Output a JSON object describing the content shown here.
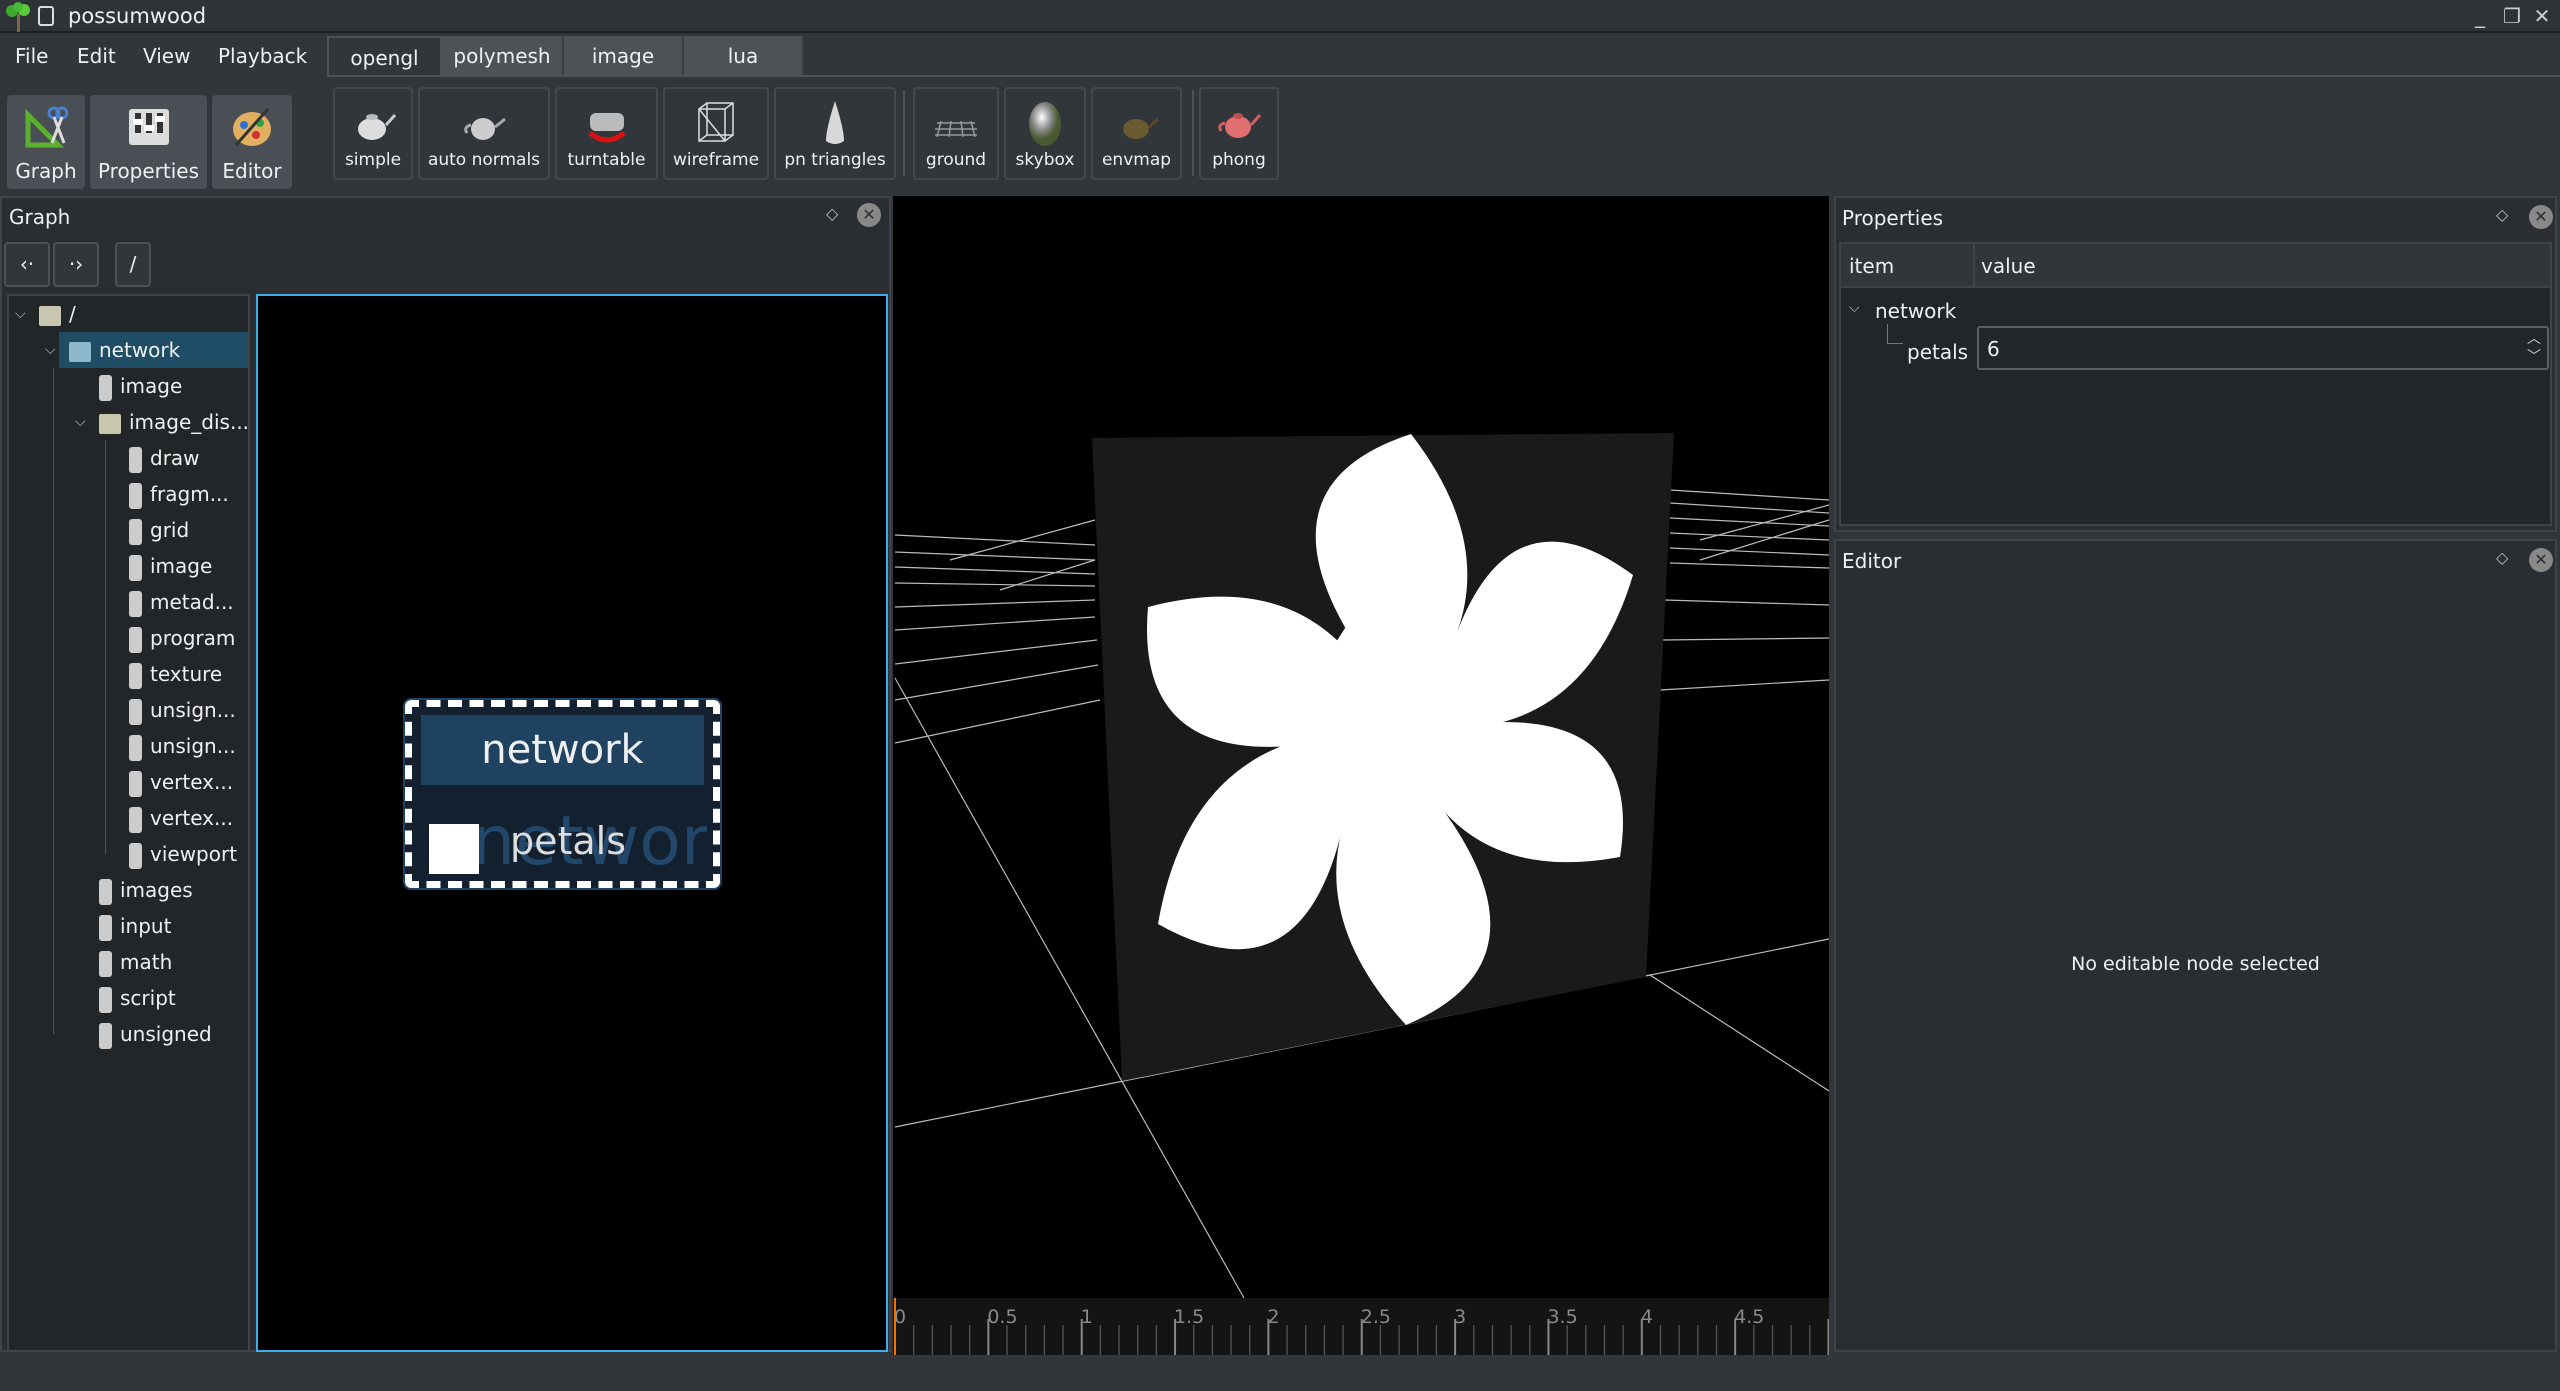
{
  "window": {
    "title": "possumwood",
    "controls": [
      "minimize",
      "maximize",
      "close"
    ]
  },
  "menu": [
    "File",
    "Edit",
    "View",
    "Playback"
  ],
  "dock_buttons": [
    {
      "label": "Graph",
      "icon": "graph-tools-icon"
    },
    {
      "label": "Properties",
      "icon": "sliders-icon"
    },
    {
      "label": "Editor",
      "icon": "palette-icon"
    }
  ],
  "tabs": [
    {
      "label": "opengl",
      "active": true
    },
    {
      "label": "polymesh",
      "active": false
    },
    {
      "label": "image",
      "active": false
    },
    {
      "label": "lua",
      "active": false
    }
  ],
  "toolbar": [
    {
      "label": "simple",
      "icon": "teapot-icon"
    },
    {
      "label": "auto normals",
      "icon": "teapot-icon"
    },
    {
      "label": "turntable",
      "icon": "car-rotate-icon"
    },
    {
      "label": "wireframe",
      "icon": "wireframe-box-icon"
    },
    {
      "label": "pn triangles",
      "icon": "cone-icon"
    },
    {
      "label": "ground",
      "icon": "ground-grid-icon"
    },
    {
      "label": "skybox",
      "icon": "sphere-icon"
    },
    {
      "label": "envmap",
      "icon": "teapot-env-icon"
    },
    {
      "label": "phong",
      "icon": "red-teapot-icon"
    }
  ],
  "graph_panel": {
    "title": "Graph",
    "nav": {
      "back": "back-icon",
      "forward": "forward-icon",
      "path": "/"
    },
    "tree": [
      {
        "label": "/",
        "depth": 0,
        "type": "folder",
        "expanded": true
      },
      {
        "label": "network",
        "depth": 1,
        "type": "folder",
        "expanded": true,
        "selected": true
      },
      {
        "label": "image",
        "depth": 2,
        "type": "node"
      },
      {
        "label": "image_dis...",
        "depth": 2,
        "type": "folder",
        "expanded": true
      },
      {
        "label": "draw",
        "depth": 3,
        "type": "node"
      },
      {
        "label": "fragm...",
        "depth": 3,
        "type": "node"
      },
      {
        "label": "grid",
        "depth": 3,
        "type": "node"
      },
      {
        "label": "image",
        "depth": 3,
        "type": "node"
      },
      {
        "label": "metad...",
        "depth": 3,
        "type": "node"
      },
      {
        "label": "program",
        "depth": 3,
        "type": "node"
      },
      {
        "label": "texture",
        "depth": 3,
        "type": "node"
      },
      {
        "label": "unsign...",
        "depth": 3,
        "type": "node"
      },
      {
        "label": "unsign...",
        "depth": 3,
        "type": "node"
      },
      {
        "label": "vertex...",
        "depth": 3,
        "type": "node"
      },
      {
        "label": "vertex...",
        "depth": 3,
        "type": "node"
      },
      {
        "label": "viewport",
        "depth": 3,
        "type": "node"
      },
      {
        "label": "images",
        "depth": 2,
        "type": "node"
      },
      {
        "label": "input",
        "depth": 2,
        "type": "node"
      },
      {
        "label": "math",
        "depth": 2,
        "type": "node"
      },
      {
        "label": "script",
        "depth": 2,
        "type": "node"
      },
      {
        "label": "unsigned",
        "depth": 2,
        "type": "node"
      }
    ],
    "node": {
      "title": "network",
      "watermark": "network",
      "port": "petals"
    }
  },
  "timeline": {
    "labels": [
      "0",
      "0.5",
      "1",
      "1.5",
      "2",
      "2.5",
      "3",
      "3.5",
      "4",
      "4.5"
    ],
    "current": 0,
    "cursor_color": "#f67400"
  },
  "properties_panel": {
    "title": "Properties",
    "columns": [
      "item",
      "value"
    ],
    "rows": [
      {
        "item": "network",
        "expanded": true
      },
      {
        "item": "petals",
        "value": "6"
      }
    ]
  },
  "editor_panel": {
    "title": "Editor",
    "message": "No editable node selected"
  },
  "colors": {
    "accent": "#3daee9",
    "selection": "#1f4d66",
    "background": "#31363b"
  }
}
